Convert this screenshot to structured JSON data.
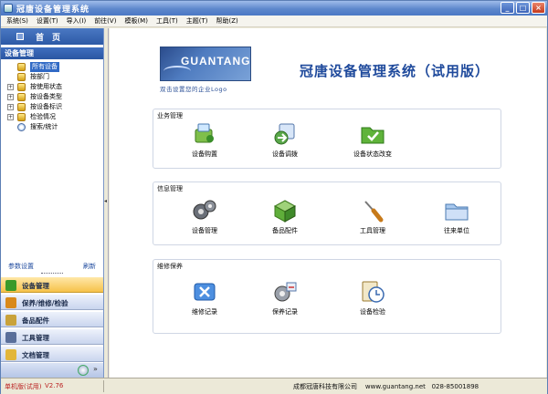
{
  "window": {
    "title": "冠唐设备管理系统"
  },
  "menu": [
    "系统(S)",
    "设置(T)",
    "导入(I)",
    "前往(V)",
    "模板(M)",
    "工具(T)",
    "主题(T)",
    "帮助(Z)"
  ],
  "sidebar": {
    "home_label": "首页",
    "tree_header": "设备管理",
    "tree": [
      {
        "label": "所有设备",
        "expander": "",
        "selected": true
      },
      {
        "label": "按部门",
        "expander": ""
      },
      {
        "label": "按使用状态",
        "expander": "+"
      },
      {
        "label": "按设备类型",
        "expander": "+"
      },
      {
        "label": "按设备标识",
        "expander": "+"
      },
      {
        "label": "检验情况",
        "expander": "+"
      },
      {
        "label": "搜索/统计",
        "expander": ""
      }
    ],
    "link_params": "参数设置",
    "link_refresh": "刷新",
    "nav": [
      {
        "label": "设备管理",
        "color": "#3a9a2a"
      },
      {
        "label": "保养/维修/检验",
        "color": "#d9891a"
      },
      {
        "label": "备品配件",
        "color": "#c9a23a"
      },
      {
        "label": "工具管理",
        "color": "#5a6f9a"
      },
      {
        "label": "文档管理",
        "color": "#e2b63a"
      }
    ]
  },
  "header": {
    "logo_text": "GUANTANG",
    "logo_slogan": "双击设置您的企业Logo",
    "app_title": "冠唐设备管理系统（试用版）"
  },
  "groups": [
    {
      "title": "业务管理",
      "tiles": [
        "设备购置",
        "设备调拨",
        "设备状态改变"
      ]
    },
    {
      "title": "信息管理",
      "tiles": [
        "设备管理",
        "备品配件",
        "工具管理",
        "往来单位"
      ]
    },
    {
      "title": "维修保养",
      "tiles": [
        "维修记录",
        "保养记录",
        "设备检验"
      ]
    }
  ],
  "status": {
    "mode": "单机版(试用)",
    "version": "V2.76",
    "company": "成都冠唐科技有限公司",
    "website": "www.guantang.net",
    "phone": "028-85001898"
  },
  "colors": {
    "accent": "#316ac5",
    "title_blue": "#1f4a9c",
    "status_red": "#b22222"
  }
}
